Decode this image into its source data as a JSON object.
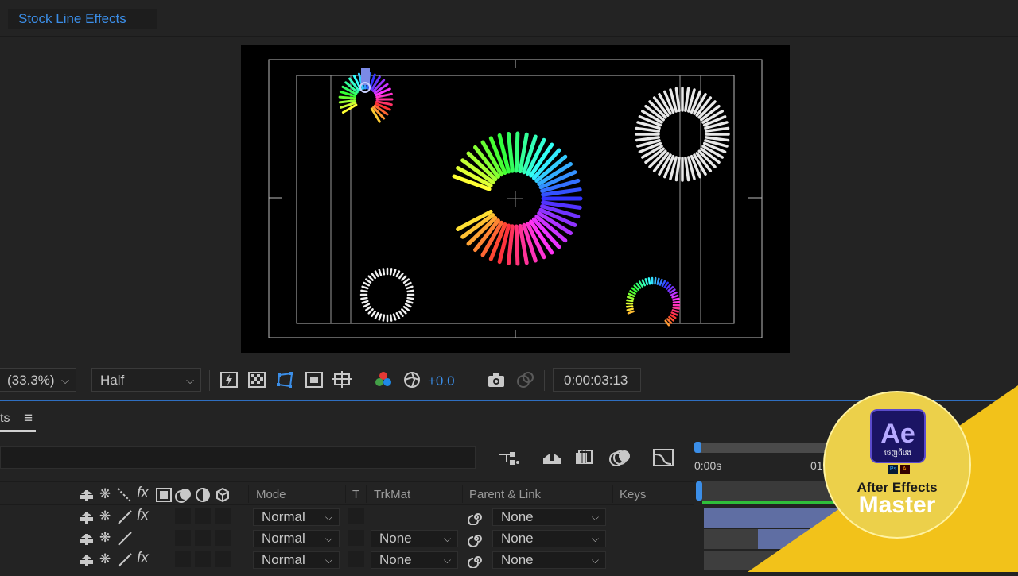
{
  "window": {
    "tab_title": "Stock Line Effects"
  },
  "toolbar": {
    "zoom_value": "(33.3%)",
    "resolution_value": "Half",
    "exposure_value": "+0.0",
    "current_time": "0:00:03:13"
  },
  "panel": {
    "tab_label": "ts",
    "menu_glyph": "≡"
  },
  "columns": {
    "mode": "Mode",
    "t": "T",
    "trkmat": "TrkMat",
    "parent_link": "Parent & Link",
    "keys": "Keys"
  },
  "layers": [
    {
      "mode": "Normal",
      "trkmat": "",
      "parent": "None",
      "has_fx": true
    },
    {
      "mode": "Normal",
      "trkmat": "None",
      "parent": "None",
      "has_fx": false
    },
    {
      "mode": "Normal",
      "trkmat": "None",
      "parent": "None",
      "has_fx": true
    }
  ],
  "timeline": {
    "ruler_start": "0:00s",
    "ruler_mark": "01"
  },
  "badge": {
    "logo_text": "Ae",
    "logo_subtext": "ចេញពីបង",
    "mini_logo_1": "Ps",
    "mini_logo_2": "Ai",
    "title_line_1": "After Effects",
    "title_line_2": "Master",
    "accent_color": "#f2c21a",
    "logo_color": "#1b1464",
    "logo_text_color": "#b6a9ff"
  },
  "colors": {
    "panel_bg": "#232323",
    "accent_blue": "#2f6fc1",
    "title_blue": "#3b8ee8"
  }
}
